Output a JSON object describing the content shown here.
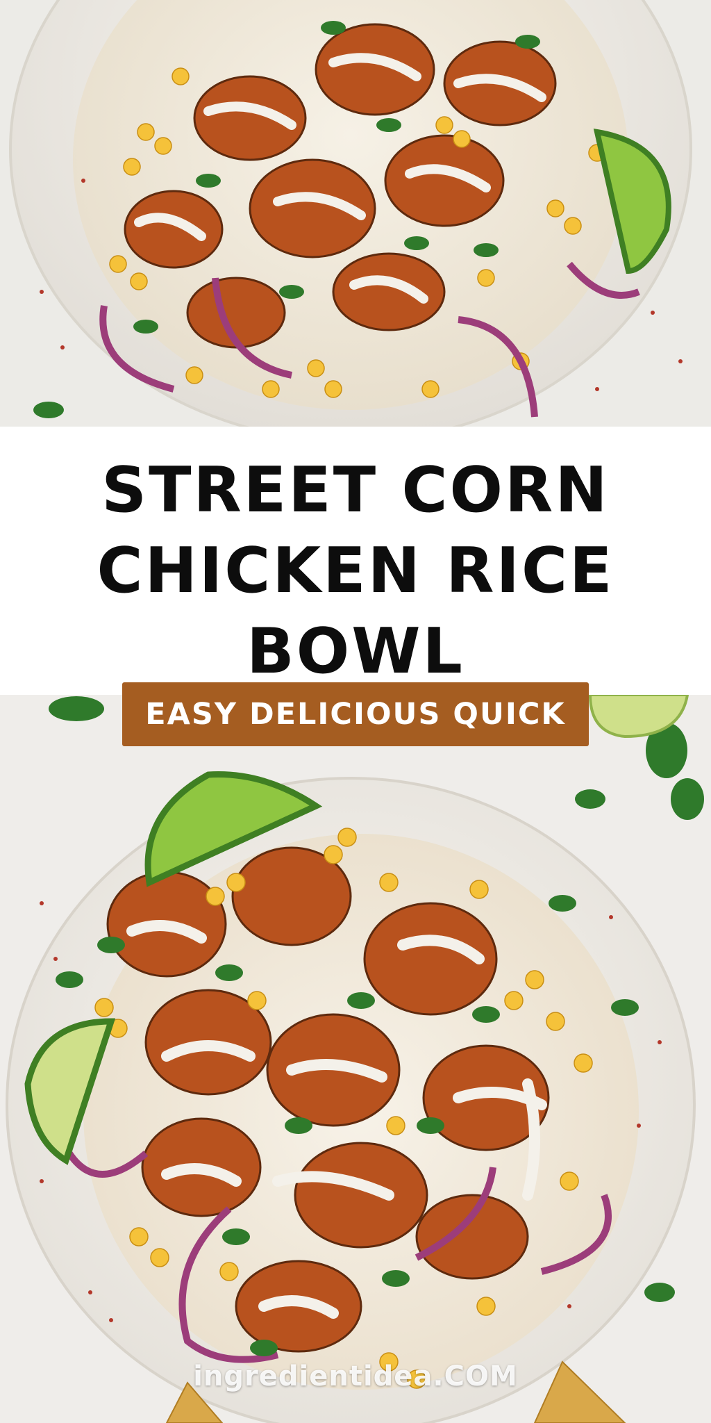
{
  "title": {
    "lines": [
      "STREET CORN",
      "CHICKEN RICE",
      "BOWL"
    ]
  },
  "tagline": "EASY DELICIOUS QUICK",
  "watermark": "ingredientidea.COM",
  "colors": {
    "tagline_background": "#a55d21",
    "title_text": "#0d0d0d",
    "band_background": "#ffffff"
  },
  "images": [
    {
      "name": "top-bowl-photo",
      "subject": "rice bowl with chicken, corn, red onion, cilantro, crema and lime wedge"
    },
    {
      "name": "bottom-bowl-photo",
      "subject": "rice bowl with chicken, corn, red onion, cilantro, crema and lime wedges"
    }
  ]
}
